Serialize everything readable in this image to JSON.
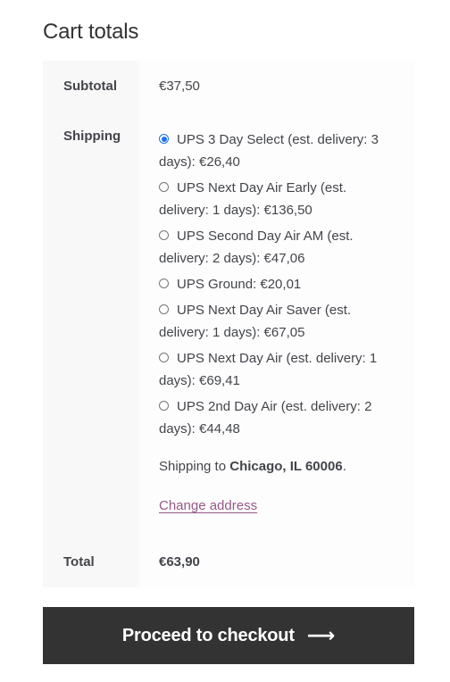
{
  "cart": {
    "title": "Cart totals",
    "subtotal_label": "Subtotal",
    "subtotal_value": "€37,50",
    "shipping_label": "Shipping",
    "shipping_options": [
      {
        "label": "UPS 3 Day Select (est. delivery: 3 days): €26,40",
        "selected": true
      },
      {
        "label": "UPS Next Day Air Early (est. delivery: 1 days): €136,50",
        "selected": false
      },
      {
        "label": "UPS Second Day Air AM (est. delivery: 2 days): €47,06",
        "selected": false
      },
      {
        "label": "UPS Ground: €20,01",
        "selected": false
      },
      {
        "label": "UPS Next Day Air Saver (est. delivery: 1 days): €67,05",
        "selected": false
      },
      {
        "label": "UPS Next Day Air (est. delivery: 1 days): €69,41",
        "selected": false
      },
      {
        "label": "UPS 2nd Day Air (est. delivery: 2 days): €44,48",
        "selected": false
      }
    ],
    "shipping_to_prefix": "Shipping to ",
    "shipping_to_location": "Chicago, IL 60006",
    "shipping_to_suffix": ".",
    "change_address_label": "Change address",
    "total_label": "Total",
    "total_value": "€63,90"
  },
  "checkout": {
    "button_label": "Proceed to checkout",
    "arrow_icon": "⟶"
  },
  "colors": {
    "accent_link": "#96588a",
    "button_bg": "#333333",
    "radio_checked": "#1a73e8"
  }
}
